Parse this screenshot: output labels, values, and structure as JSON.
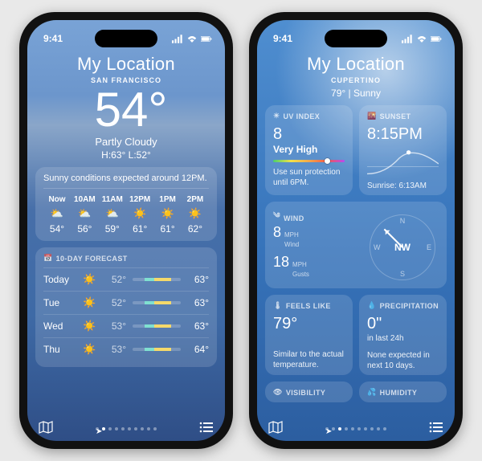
{
  "statusbar": {
    "time": "9:41"
  },
  "left": {
    "title": "My Location",
    "subtitle": "SAN FRANCISCO",
    "temp": "54°",
    "condition": "Partly Cloudy",
    "hilo": "H:63°  L:52°",
    "hourly_summary": "Sunny conditions expected around 12PM.",
    "hours": [
      {
        "time": "Now",
        "icon": "⛅",
        "temp": "54°"
      },
      {
        "time": "10AM",
        "icon": "⛅",
        "temp": "56°"
      },
      {
        "time": "11AM",
        "icon": "⛅",
        "temp": "59°"
      },
      {
        "time": "12PM",
        "icon": "☀️",
        "temp": "61°"
      },
      {
        "time": "1PM",
        "icon": "☀️",
        "temp": "61°"
      },
      {
        "time": "2PM",
        "icon": "☀️",
        "temp": "62°"
      }
    ],
    "daily_header": "10-DAY FORECAST",
    "daily": [
      {
        "day": "Today",
        "icon": "☀️",
        "lo": "52°",
        "hi": "63°"
      },
      {
        "day": "Tue",
        "icon": "☀️",
        "lo": "52°",
        "hi": "63°"
      },
      {
        "day": "Wed",
        "icon": "☀️",
        "lo": "53°",
        "hi": "63°"
      },
      {
        "day": "Thu",
        "icon": "☀️",
        "lo": "53°",
        "hi": "64°"
      }
    ]
  },
  "right": {
    "title": "My Location",
    "subtitle": "CUPERTINO",
    "line2": "79°  |  Sunny",
    "uv": {
      "header": "UV INDEX",
      "value": "8",
      "level": "Very High",
      "note": "Use sun protection until 6PM."
    },
    "sunset": {
      "header": "SUNSET",
      "time": "8:15PM",
      "sunrise": "Sunrise: 6:13AM"
    },
    "wind": {
      "header": "WIND",
      "speed": "8",
      "speed_unit": "MPH",
      "speed_label": "Wind",
      "gusts": "18",
      "gusts_unit": "MPH",
      "gusts_label": "Gusts",
      "direction": "NW"
    },
    "feels": {
      "header": "FEELS LIKE",
      "value": "79°",
      "note": "Similar to the actual temperature."
    },
    "precip": {
      "header": "PRECIPITATION",
      "value": "0\"",
      "sub": "in last 24h",
      "note": "None expected in next 10 days."
    },
    "vis": {
      "header": "VISIBILITY"
    },
    "hum": {
      "header": "HUMIDITY"
    }
  },
  "compass_labels": {
    "n": "N",
    "s": "S",
    "e": "E",
    "w": "W"
  }
}
